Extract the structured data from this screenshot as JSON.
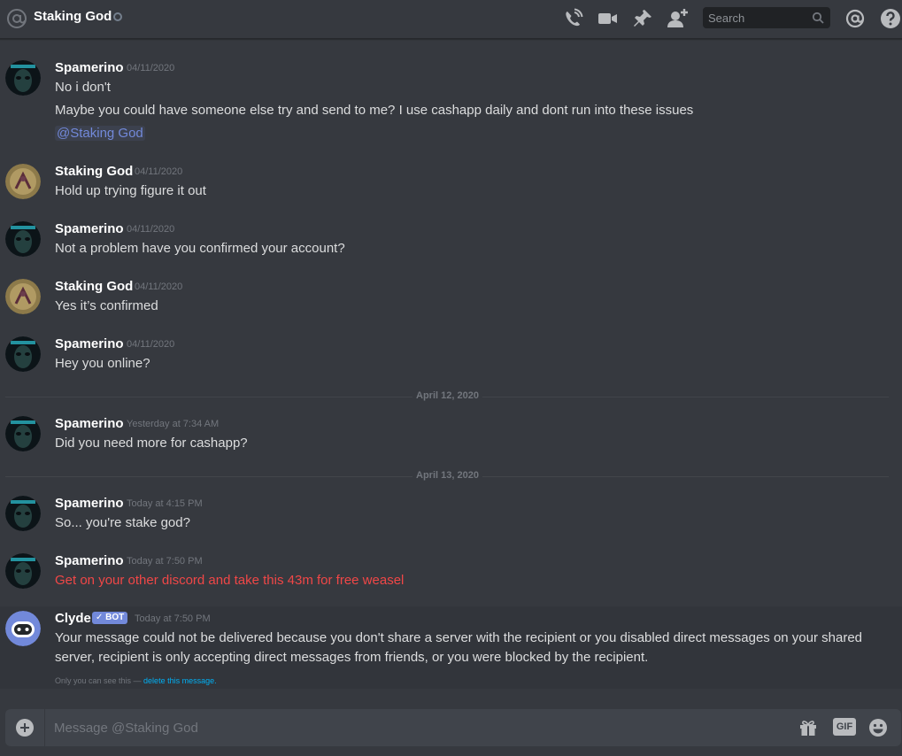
{
  "header": {
    "channel_name": "Staking God",
    "search_placeholder": "Search",
    "icons": [
      "at-icon",
      "status-icon",
      "call-icon",
      "video-icon",
      "pin-icon",
      "add-friend-icon",
      "search-icon",
      "mentions-icon",
      "help-icon"
    ]
  },
  "messages": [
    {
      "author": "Spamerino",
      "timestamp": "04/11/2020",
      "lines": [
        "No i don't",
        "Maybe you could have someone else try and send to me? I use cashapp daily and dont run into these issues"
      ],
      "mention": "@Staking God"
    },
    {
      "author": "Staking God",
      "timestamp": "04/11/2020",
      "lines": [
        "Hold up trying figure it out"
      ]
    },
    {
      "author": "Spamerino",
      "timestamp": "04/11/2020",
      "lines": [
        "Not a problem have you confirmed your account?"
      ]
    },
    {
      "author": "Staking God",
      "timestamp": "04/11/2020",
      "lines": [
        "Yes it’s confirmed"
      ]
    },
    {
      "author": "Spamerino",
      "timestamp": "04/11/2020",
      "lines": [
        "Hey you online?"
      ]
    },
    {
      "author": "Spamerino",
      "timestamp": "Yesterday at 7:34 AM",
      "lines": [
        "Did you need more for cashapp?"
      ]
    },
    {
      "author": "Spamerino",
      "timestamp": "Today at 4:15 PM",
      "lines": [
        "So... you're stake god?"
      ]
    },
    {
      "author": "Spamerino",
      "timestamp": "Today at 7:50 PM",
      "lines": [
        "Get on your other discord and take this 43m for free weasel"
      ],
      "error": true
    },
    {
      "author": "Clyde",
      "bot_tag": "✓ BOT",
      "timestamp": "Today at 7:50 PM",
      "lines": [
        "Your message could not be delivered because you don't share a server with the recipient or you disabled direct messages on your shared",
        "server, recipient is only accepting direct messages from friends, or you were blocked by the recipient."
      ],
      "ephemeral_note": "Only you can see this — ",
      "ephemeral_link": "delete this message."
    }
  ],
  "dividers": [
    "April 12, 2020",
    "April 13, 2020"
  ],
  "composer": {
    "placeholder": "Message @Staking God",
    "gif_label": "GIF",
    "icons": [
      "plus-icon",
      "gift-icon",
      "gif-icon",
      "emoji-icon"
    ]
  },
  "colors": {
    "background": "#36393f",
    "mention": "#7289da",
    "error_text": "#f04747",
    "link": "#00b0f4"
  }
}
